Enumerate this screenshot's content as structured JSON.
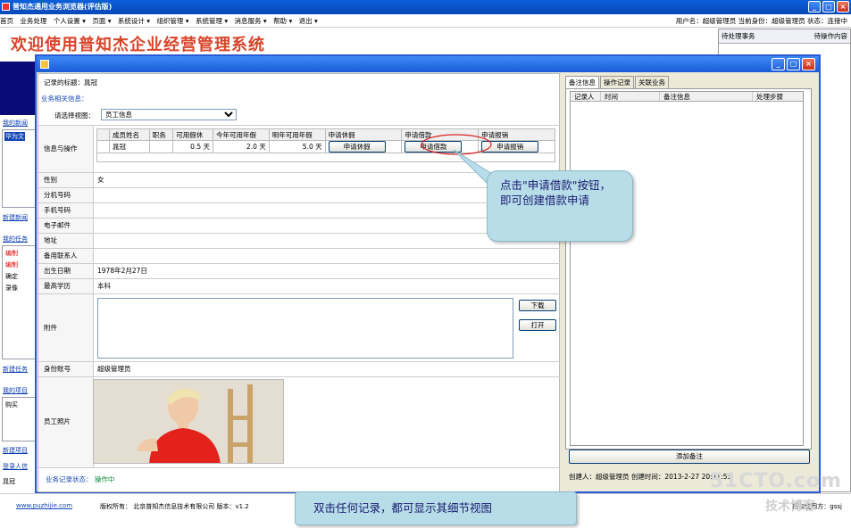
{
  "browser": {
    "title": "普知杰通用业务浏览器(评估版)",
    "menu": [
      "首页",
      "业务处理",
      "个人设置 ▾",
      "页面 ▾",
      "系统设计 ▾",
      "组织管理 ▾",
      "系统管理 ▾",
      "消息服务 ▾",
      "帮助 ▾",
      "退出 ▾"
    ],
    "user_info": "用户名：超级管理员   当前身份：超级管理员   状态：连接中"
  },
  "banner": {
    "title": "欢迎使用普知杰企业经营管理系统"
  },
  "right_panel": {
    "col1": "待处理事务",
    "col2": "待操作内容"
  },
  "left_strip": {
    "sec1": "我的新闻",
    "item1": "华为文",
    "link1": "新建新闻",
    "sec2": "我的任务",
    "task1": "编制",
    "task2": "编制",
    "task3": "确定",
    "task4": "录像",
    "link2": "新建任务",
    "sec3": "我的项目",
    "proj1": "购买",
    "link3": "新建项目",
    "sec4": "登录人信",
    "login1": "晁冠"
  },
  "modal": {
    "record_title_label": "记录的标题：",
    "record_title_value": "晁冠",
    "related_info_label": "业务相关信息：",
    "view_label": "请选择视图：",
    "view_selected": "员工信息",
    "info_ops_label": "信息与操作",
    "grid": {
      "headers": [
        "成员姓名",
        "职务",
        "可用假休",
        "今年可用年假",
        "明年可用年假",
        "申请休假",
        "申请借款",
        "申请报销"
      ],
      "row": [
        "晁冠",
        "",
        "0.5 天",
        "2.0 天",
        "5.0 天"
      ],
      "buttons": [
        "申请休假",
        "申请借款",
        "申请报销"
      ]
    },
    "fields": [
      {
        "label": "性别",
        "value": "女"
      },
      {
        "label": "分机号码",
        "value": ""
      },
      {
        "label": "手机号码",
        "value": ""
      },
      {
        "label": "电子邮件",
        "value": ""
      },
      {
        "label": "地址",
        "value": ""
      },
      {
        "label": "备用联系人",
        "value": ""
      },
      {
        "label": "出生日期",
        "value": "1978年2月27日"
      },
      {
        "label": "最高学历",
        "value": "本科"
      }
    ],
    "attachment_label": "附件",
    "download_btn": "下载",
    "open_btn": "打开",
    "account_label": "身份账号",
    "account_value": "超级管理员",
    "photo_label": "员工照片",
    "status_label": "业务记录状态：",
    "status_value": "操作中",
    "tabs": [
      "备注信息",
      "操作记录",
      "关联业务"
    ],
    "notes_headers": [
      "记录人",
      "时间",
      "备注信息",
      "处理步骤"
    ],
    "add_note_btn": "添加备注",
    "creator": "创建人：超级管理员   创建时间：2013-2-27  20:41:53"
  },
  "callouts": {
    "top": "点击\"申请借款\"按钮，即可创建借款申请",
    "bottom": "双击任何记录，都可显示其细节视图"
  },
  "footer": {
    "site": "www.puzhijie.com",
    "copyright": "版权所有：  北京普知杰信息技术有限公司   版本：v1.2",
    "license": "授权使用方：gssj"
  },
  "watermark": {
    "line1": "51CTO.com",
    "line2": "技术博客"
  }
}
